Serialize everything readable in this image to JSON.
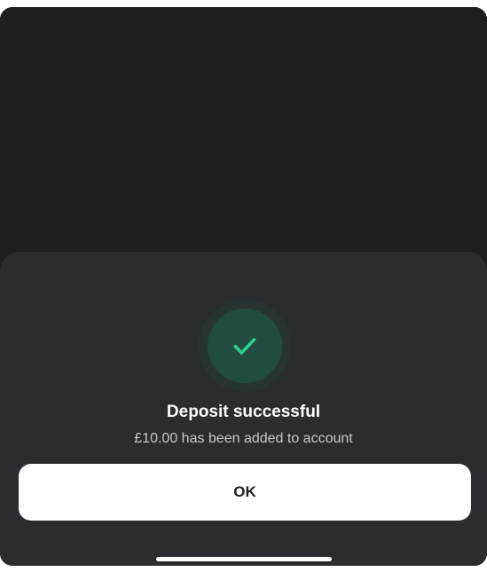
{
  "dialog": {
    "icon": "checkmark-icon",
    "accent_color": "#2ecc8f",
    "badge_color": "#224c3f",
    "title": "Deposit successful",
    "message": "£10.00 has been added to account",
    "ok_label": "OK"
  }
}
